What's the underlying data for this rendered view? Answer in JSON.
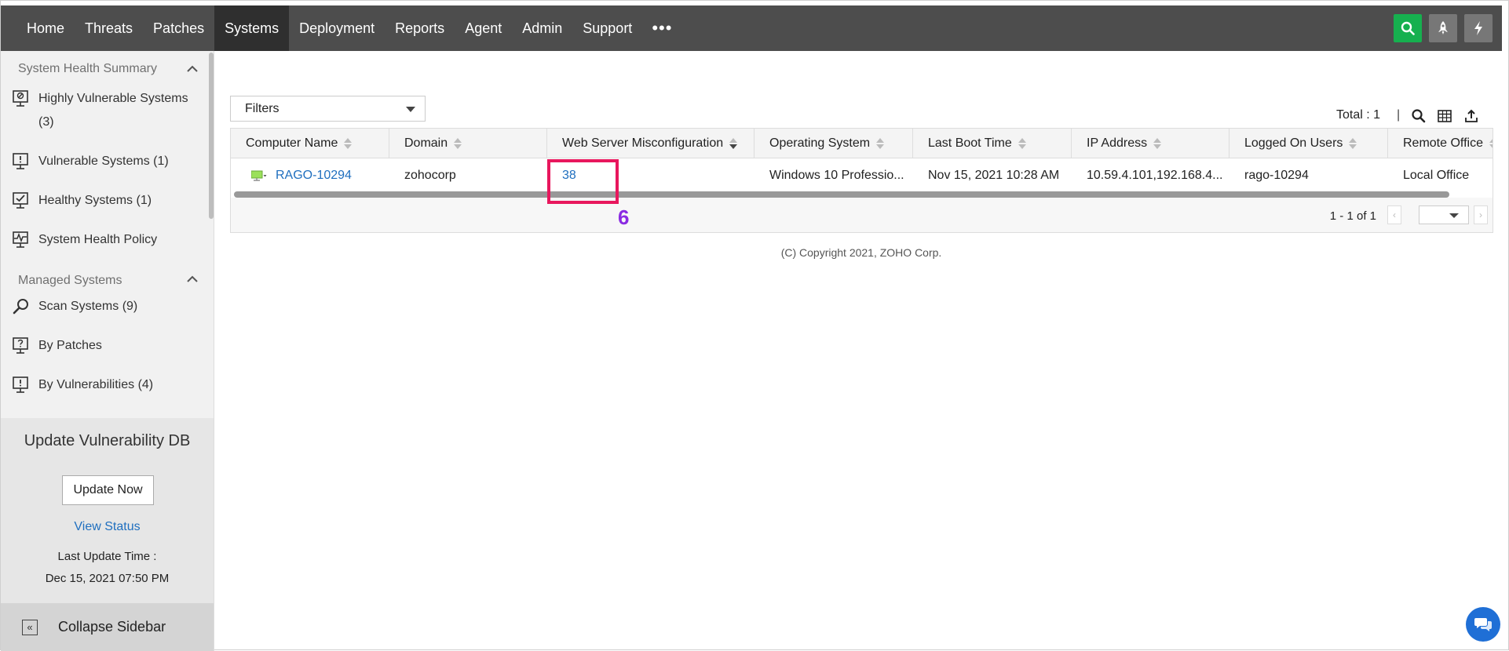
{
  "nav": {
    "items": [
      "Home",
      "Threats",
      "Patches",
      "Systems",
      "Deployment",
      "Reports",
      "Agent",
      "Admin",
      "Support"
    ],
    "active": "Systems",
    "more_label": "•••"
  },
  "sidebar": {
    "section1": {
      "title": "System Health Summary"
    },
    "items1": [
      {
        "label": "Highly Vulnerable Systems",
        "count": "(3)"
      },
      {
        "label": "Vulnerable Systems (1)"
      },
      {
        "label": "Healthy Systems (1)"
      },
      {
        "label": "System Health Policy"
      }
    ],
    "section2": {
      "title": "Managed Systems"
    },
    "items2": [
      {
        "label": "Scan Systems (9)"
      },
      {
        "label": "By Patches"
      },
      {
        "label": "By Vulnerabilities (4)"
      }
    ],
    "update": {
      "title": "Update Vulnerability DB",
      "button": "Update Now",
      "view_status": "View Status",
      "last_update_label": "Last Update Time :",
      "last_update_value": "Dec 15, 2021 07:50 PM"
    },
    "collapse_label": "Collapse Sidebar"
  },
  "main": {
    "filters_label": "Filters",
    "total": "Total : 1",
    "separator": "|",
    "columns": [
      "Computer Name",
      "Domain",
      "Web Server Misconfiguration",
      "Operating System",
      "Last Boot Time",
      "IP Address",
      "Logged On Users",
      "Remote Office"
    ],
    "row": {
      "computer_name": "RAGO-10294",
      "domain": "zohocorp",
      "web_server_misconfiguration": "38",
      "operating_system": "Windows 10 Professio...",
      "last_boot_time": "Nov 15, 2021 10:28 AM",
      "ip_address": "10.59.4.101,192.168.4...",
      "logged_on_users": "rago-10294",
      "remote_office": "Local Office"
    },
    "pager": "1 - 1 of 1",
    "step_number": "6",
    "copyright": "(C) Copyright 2021, ZOHO Corp."
  },
  "colors": {
    "topbar": "#4d4d4d",
    "active_nav": "#2f2f2f",
    "search_button": "#16b04f",
    "link": "#1f6fbf",
    "highlight_box": "#e8175d",
    "step_number": "#8a2be2"
  }
}
